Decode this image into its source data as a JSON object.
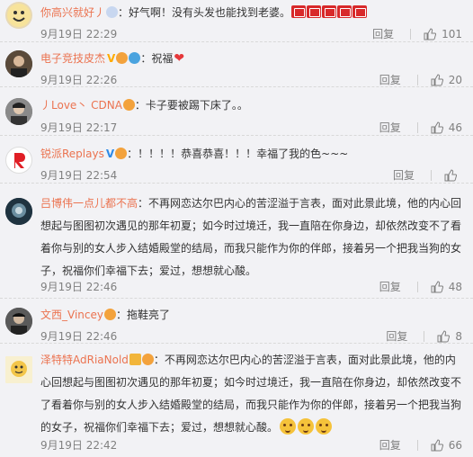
{
  "comments": [
    {
      "username": "你高兴就好丿",
      "text": "：好气啊！没有头发也能找到老婆。",
      "time": "9月19日 22:29",
      "reply": "回复",
      "likes": "101",
      "emoji_count": 5,
      "avatar_color": "#e8d9b5"
    },
    {
      "username": "电子竞技皮杰",
      "text": "：祝福",
      "time": "9月19日 22:26",
      "reply": "回复",
      "likes": "20",
      "avatar_color": "#3c3c3c"
    },
    {
      "username": "丿Love丶 CDNA",
      "text": "：卡子要被踢下床了。。",
      "time": "9月19日 22:17",
      "reply": "回复",
      "likes": "46",
      "avatar_color": "#6a6a6a"
    },
    {
      "username": "锐派Replays",
      "text": "：！！！！恭喜恭喜！！！幸福了我的色~~~",
      "time": "9月19日 22:54",
      "reply": "回复",
      "likes": "",
      "avatar_color": "#ffffff"
    },
    {
      "username": "吕博伟一点儿都不高",
      "text": "：不再网恋达尔巴内心的苦涩溢于言表，面对此景此境，他的内心回想起与图图初次遇见的那年初夏；如今时过境迁，我一直陪在你身边，却依然改变不了看着你与别的女人步入结婚殿堂的结局，而我只能作为你的伴郎，接着另一个把我当狗的女子，祝福你们幸福下去；爱过，想想就心酸。",
      "time": "9月19日 22:46",
      "reply": "回复",
      "likes": "48",
      "avatar_color": "#1f3340"
    },
    {
      "username": "文西_Vincey",
      "text": "：拖鞋亮了",
      "time": "9月19日 22:46",
      "reply": "回复",
      "likes": "8",
      "avatar_color": "#4a4a4a"
    },
    {
      "username": "泽特特AdRiaNold",
      "text": "：不再网恋达尔巴内心的苦涩溢于言表，面对此景此境，他的内心回想起与图图初次遇见的那年初夏；如今时过境迁，我一直陪在你身边，却依然改变不了看着你与别的女人步入结婚殿堂的结局，而我只能作为你的伴郎，接着另一个把我当狗的女子，祝福你们幸福下去；爱过，想想就心酸。",
      "time": "9月19日 22:42",
      "reply": "回复",
      "likes": "66",
      "avatar_color": "#f4e6a8"
    }
  ],
  "colors": {
    "username": "#eb7350",
    "meta": "#808080",
    "background": "#f2f2f5"
  }
}
